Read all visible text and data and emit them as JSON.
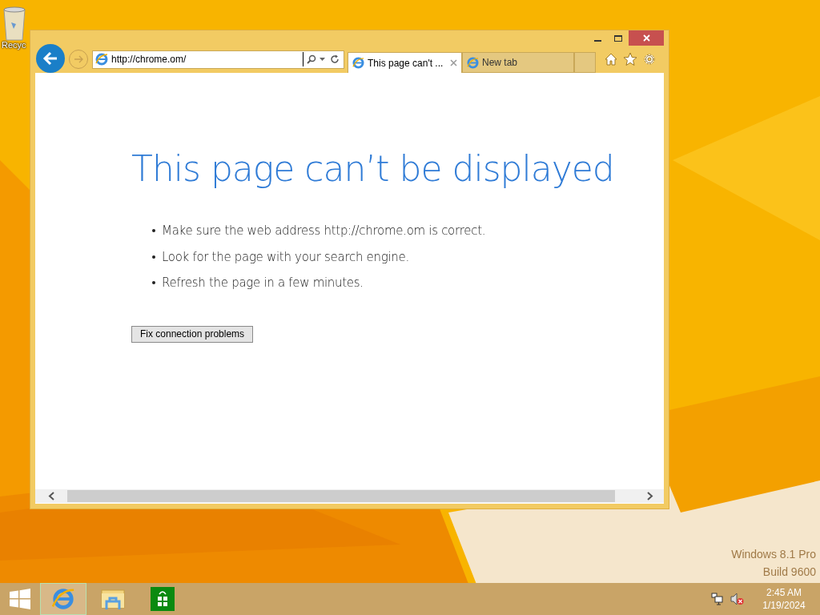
{
  "desktop_icons": [
    {
      "label": "Recyc"
    }
  ],
  "browser": {
    "address": {
      "value": "http://chrome.om/"
    },
    "tabs": [
      {
        "label": "This page can't ...",
        "selected": true,
        "closable": true
      },
      {
        "label": "New tab",
        "selected": false,
        "closable": false
      }
    ],
    "page": {
      "heading": "This page can’t be displayed",
      "bullets": [
        "Make sure the web address http://chrome.om is correct.",
        "Look for the page with your search engine.",
        "Refresh the page in a few minutes."
      ],
      "button": "Fix connection problems"
    }
  },
  "watermark": [
    "Windows 8.1 Pro",
    "Build 9600"
  ],
  "taskbar": {
    "apps": [
      {
        "kind": "ie",
        "selected": true
      },
      {
        "kind": "explorer",
        "selected": false
      },
      {
        "kind": "store",
        "selected": false
      }
    ],
    "clock": {
      "time": "2:45 AM",
      "date": "1/19/2024"
    }
  }
}
